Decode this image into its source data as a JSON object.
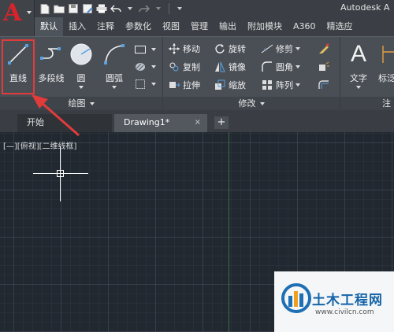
{
  "app": {
    "logo_letter": "A",
    "title": "Autodesk A",
    "accent_color": "#d8232a"
  },
  "quick_access": [
    {
      "icon": "new-file-icon"
    },
    {
      "icon": "open-folder-icon"
    },
    {
      "icon": "save-icon"
    },
    {
      "icon": "save-as-icon"
    },
    {
      "icon": "print-icon"
    },
    {
      "icon": "undo-icon"
    },
    {
      "icon": "redo-icon"
    }
  ],
  "ribbon_tabs": [
    "默认",
    "插入",
    "注释",
    "参数化",
    "视图",
    "管理",
    "输出",
    "附加模块",
    "A360",
    "精选应"
  ],
  "ribbon": {
    "draw": {
      "label": "绘图",
      "line": "直线",
      "polyline": "多段线",
      "circle": "圆",
      "arc": "圆弧"
    },
    "modify": {
      "label": "修改",
      "move": "移动",
      "rotate": "旋转",
      "trim": "修剪",
      "copy": "复制",
      "mirror": "镜像",
      "fillet": "圆角",
      "stretch": "拉伸",
      "scale": "缩放",
      "array": "阵列"
    },
    "annotation": {
      "text": "文字",
      "dimension": "标泛",
      "label_partial": "注"
    }
  },
  "file_tabs": {
    "start": "开始",
    "drawing": "Drawing1*",
    "close": "×",
    "add": "+"
  },
  "canvas": {
    "viewport_label": "[—][俯视][二维线框]"
  },
  "watermark": {
    "title": "土木工程网",
    "url": "www.civilcn.com"
  }
}
